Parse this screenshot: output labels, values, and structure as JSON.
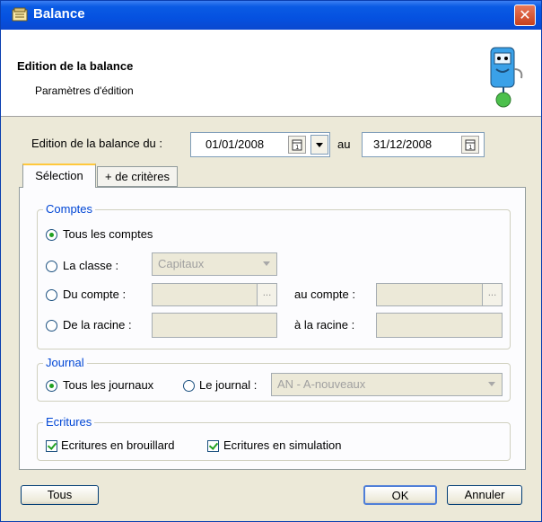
{
  "window": {
    "title": "Balance"
  },
  "header": {
    "title": "Edition de la balance",
    "subtitle": "Paramètres d'édition"
  },
  "dates": {
    "label_from": "Edition de la balance du :",
    "from_value": "01/01/2008",
    "label_to": "au",
    "to_value": "31/12/2008"
  },
  "tabs": [
    {
      "label": "Sélection",
      "active": true
    },
    {
      "label": "+ de critères",
      "active": false
    }
  ],
  "comptes": {
    "legend": "Comptes",
    "all_label": "Tous les comptes",
    "classe_label": "La classe :",
    "classe_value": "Capitaux",
    "du_compte_label": "Du compte :",
    "au_compte_label": "au compte :",
    "racine_label": "De la racine :",
    "a_racine_label": "à la racine :"
  },
  "journal": {
    "legend": "Journal",
    "all_label": "Tous les journaux",
    "single_label": "Le journal :",
    "journal_value": "AN - A-nouveaux"
  },
  "ecritures": {
    "legend": "Ecritures",
    "brouillard_label": "Ecritures en brouillard",
    "simulation_label": "Ecritures en simulation"
  },
  "buttons": {
    "tous": "Tous",
    "ok": "OK",
    "annuler": "Annuler"
  },
  "colors": {
    "title_bar": "#0551e0",
    "legend": "#0046d5",
    "accent_check": "#21a121"
  }
}
